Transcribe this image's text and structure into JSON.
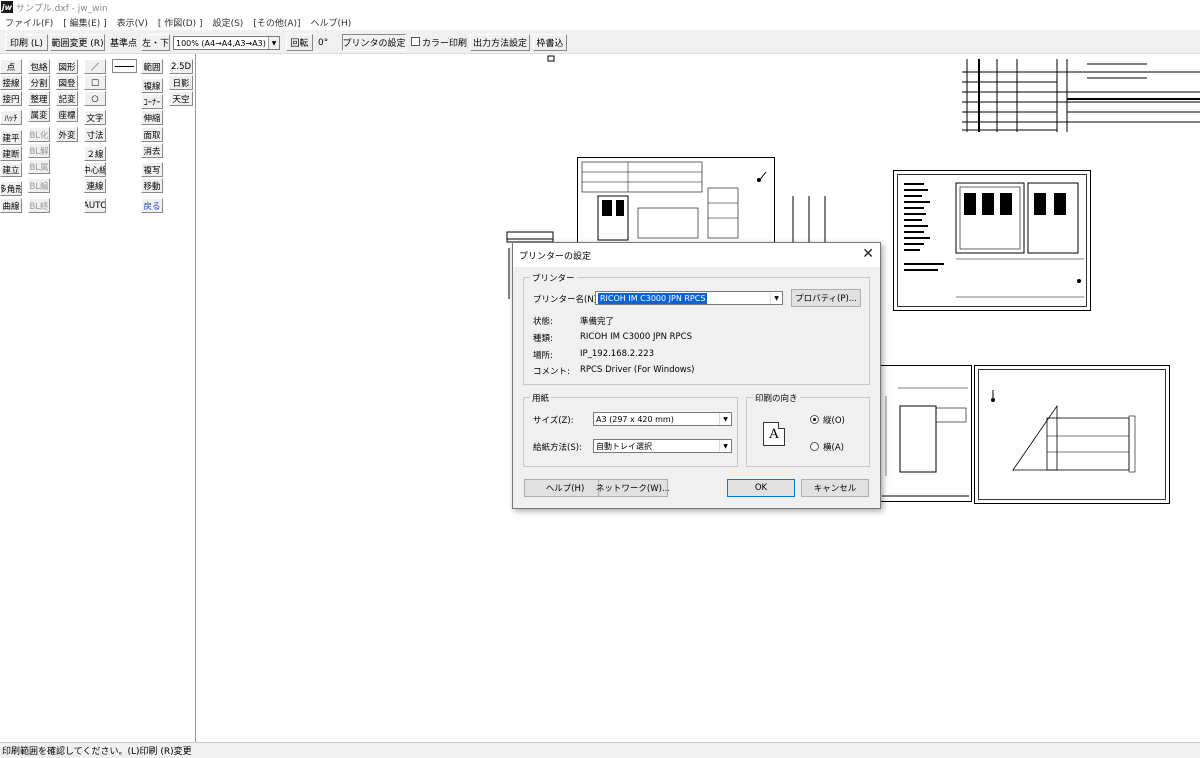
{
  "window": {
    "logo": "jw",
    "title": "サンプル.dxf - jw_win"
  },
  "menu": [
    "ファイル(F)",
    "[ 編集(E) ]",
    "表示(V)",
    "[ 作図(D) ]",
    "設定(S)",
    "[その他(A)]",
    "ヘルプ(H)"
  ],
  "toolbar": {
    "print": "印刷 (L)",
    "range_change": "範囲変更 (R)",
    "base_point_label": "基準点",
    "base_point": "左・下",
    "scale": "100% (A4→A4,A3→A3)",
    "rotate": "回転",
    "rotate_angle": "0°",
    "printer_settings": "プリンタの設定",
    "color_print": "カラー印刷",
    "output_method": "出力方法設定",
    "frame_write": "枠書込"
  },
  "left_tools": {
    "col1": [
      "点",
      "接線",
      "接円",
      "ﾊｯﾁ",
      "建平",
      "建断",
      "建立",
      "多角形",
      "曲線"
    ],
    "col2": [
      "包絡",
      "分割",
      "整理",
      "属変",
      "BL化",
      "BL解",
      "BL属",
      "BL編",
      "BL終"
    ],
    "col3": [
      "図形",
      "図登",
      "記変",
      "座標",
      "外変"
    ],
    "col4": [
      "／",
      "□",
      "○",
      "文字",
      "寸法",
      "２線",
      "中心線",
      "連線",
      "AUTO"
    ],
    "col5": [
      "範囲",
      "複線",
      "ｺｰﾅｰ",
      "伸縮",
      "面取",
      "消去",
      "複写",
      "移動",
      "戻る"
    ],
    "col6": [
      "2.5D",
      "日影",
      "天空"
    ]
  },
  "dialog": {
    "title": "プリンターの設定",
    "printer_group": "プリンター",
    "printer_name_label": "プリンター名(N):",
    "printer_name": "RICOH IM C3000 JPN RPCS",
    "properties_button": "プロパティ(P)...",
    "status_label": "状態:",
    "status_value": "準備完了",
    "type_label": "種類:",
    "type_value": "RICOH IM C3000 JPN RPCS",
    "location_label": "場所:",
    "location_value": "IP_192.168.2.223",
    "comment_label": "コメント:",
    "comment_value": "RPCS Driver (For Windows)",
    "paper_group": "用紙",
    "size_label": "サイズ(Z):",
    "size_value": "A3 (297 x 420 mm)",
    "source_label": "給紙方法(S):",
    "source_value": "自動トレイ選択",
    "orientation_group": "印刷の向き",
    "portrait": "縦(O)",
    "landscape": "横(A)",
    "orientation_selected": "portrait",
    "help_button": "ヘルプ(H)",
    "network_button": "ネットワーク(W)...",
    "ok_button": "OK",
    "cancel_button": "キャンセル"
  },
  "status_bar": "印刷範囲を確認してください。(L)印刷 (R)変更"
}
